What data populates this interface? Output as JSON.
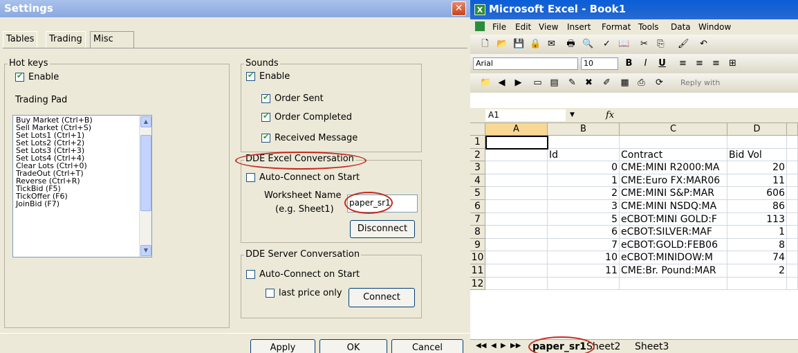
{
  "settings": {
    "title": "Settings",
    "tabs": [
      "Tables",
      "Trading",
      "Misc"
    ],
    "hotkeys": {
      "legend": "Hot keys",
      "enable_label": "Enable",
      "trading_pad_label": "Trading Pad",
      "items": [
        "Buy Market  (Ctrl+B)",
        "Sell Market  (Ctrl+S)",
        "Set Lots1  (Ctrl+1)",
        "Set Lots2  (Ctrl+2)",
        "Set Lots3  (Ctrl+3)",
        "Set Lots4  (Ctrl+4)",
        "Clear Lots  (Ctrl+0)",
        "TradeOut  (Ctrl+T)",
        "Reverse  (Ctrl+R)",
        "TickBid  (F5)",
        "TickOffer  (F6)",
        "JoinBid  (F7)"
      ]
    },
    "sounds": {
      "legend": "Sounds",
      "enable_label": "Enable",
      "order_sent": "Order Sent",
      "order_completed": "Order Completed",
      "received_message": "Received Message"
    },
    "dde_excel": {
      "legend": "DDE Excel Conversation",
      "auto_connect": "Auto-Connect on Start",
      "worksheet_label": "Worksheet Name",
      "worksheet_hint": "(e.g. Sheet1)",
      "worksheet_value": "paper_sr1",
      "disconnect": "Disconnect"
    },
    "dde_server": {
      "legend": "DDE Server Conversation",
      "auto_connect": "Auto-Connect on Start",
      "last_price_only": "last price only",
      "connect": "Connect"
    },
    "buttons": {
      "apply": "Apply",
      "ok": "OK",
      "cancel": "Cancel"
    },
    "close_glyph": "✕"
  },
  "excel": {
    "title": "Microsoft Excel - Book1",
    "app_glyph": "X",
    "menu": [
      "File",
      "Edit",
      "View",
      "Insert",
      "Format",
      "Tools",
      "Data",
      "Window"
    ],
    "font_name": "Arial",
    "font_size": "10",
    "bold": "B",
    "italic": "I",
    "underline": "U",
    "reply_with": "Reply with",
    "name_box": "A1",
    "fx": "fx",
    "columns": [
      "A",
      "B",
      "C",
      "D"
    ],
    "rows": [
      {
        "n": "1",
        "b": "",
        "c": "",
        "d": ""
      },
      {
        "n": "2",
        "b": "Id",
        "c": "Contract",
        "d": "Bid Vol"
      },
      {
        "n": "3",
        "b": "0",
        "c": "CME:MINI R2000:MA",
        "d": "20"
      },
      {
        "n": "4",
        "b": "1",
        "c": "CME:Euro FX:MAR06",
        "d": "11"
      },
      {
        "n": "5",
        "b": "2",
        "c": "CME:MINI S&P:MAR",
        "d": "606"
      },
      {
        "n": "6",
        "b": "3",
        "c": "CME:MINI NSDQ:MA",
        "d": "86"
      },
      {
        "n": "7",
        "b": "5",
        "c": "eCBOT:MINI GOLD:F",
        "d": "113"
      },
      {
        "n": "8",
        "b": "6",
        "c": "eCBOT:SILVER:MAF",
        "d": "1"
      },
      {
        "n": "9",
        "b": "7",
        "c": "eCBOT:GOLD:FEB06",
        "d": "8"
      },
      {
        "n": "10",
        "b": "10",
        "c": "eCBOT:MINIDOW:M",
        "d": "74"
      },
      {
        "n": "11",
        "b": "11",
        "c": "CME:Br. Pound:MAR",
        "d": "2"
      },
      {
        "n": "12",
        "b": "",
        "c": "",
        "d": ""
      }
    ],
    "sheet_tabs": [
      "paper_sr1",
      "Sheet2",
      "Sheet3"
    ]
  }
}
